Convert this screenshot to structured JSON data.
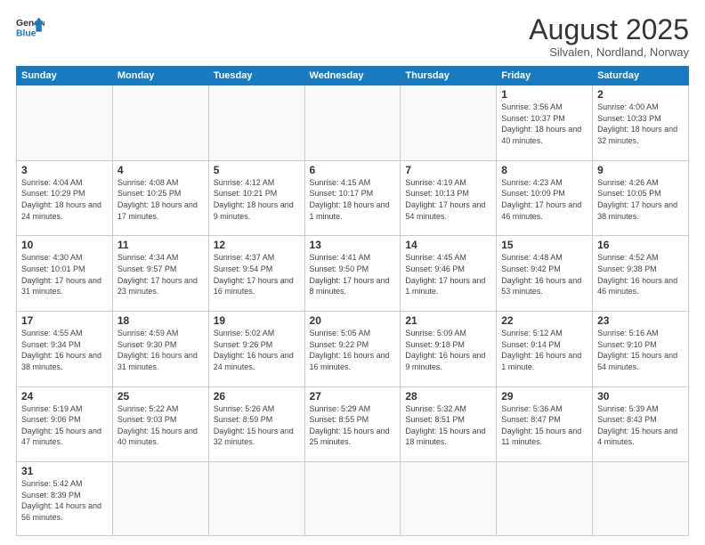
{
  "header": {
    "logo_general": "General",
    "logo_blue": "Blue",
    "month_title": "August 2025",
    "subtitle": "Silvalen, Nordland, Norway"
  },
  "days_of_week": [
    "Sunday",
    "Monday",
    "Tuesday",
    "Wednesday",
    "Thursday",
    "Friday",
    "Saturday"
  ],
  "weeks": [
    [
      {
        "day": "",
        "info": ""
      },
      {
        "day": "",
        "info": ""
      },
      {
        "day": "",
        "info": ""
      },
      {
        "day": "",
        "info": ""
      },
      {
        "day": "",
        "info": ""
      },
      {
        "day": "1",
        "info": "Sunrise: 3:56 AM\nSunset: 10:37 PM\nDaylight: 18 hours and 40 minutes."
      },
      {
        "day": "2",
        "info": "Sunrise: 4:00 AM\nSunset: 10:33 PM\nDaylight: 18 hours and 32 minutes."
      }
    ],
    [
      {
        "day": "3",
        "info": "Sunrise: 4:04 AM\nSunset: 10:29 PM\nDaylight: 18 hours and 24 minutes."
      },
      {
        "day": "4",
        "info": "Sunrise: 4:08 AM\nSunset: 10:25 PM\nDaylight: 18 hours and 17 minutes."
      },
      {
        "day": "5",
        "info": "Sunrise: 4:12 AM\nSunset: 10:21 PM\nDaylight: 18 hours and 9 minutes."
      },
      {
        "day": "6",
        "info": "Sunrise: 4:15 AM\nSunset: 10:17 PM\nDaylight: 18 hours and 1 minute."
      },
      {
        "day": "7",
        "info": "Sunrise: 4:19 AM\nSunset: 10:13 PM\nDaylight: 17 hours and 54 minutes."
      },
      {
        "day": "8",
        "info": "Sunrise: 4:23 AM\nSunset: 10:09 PM\nDaylight: 17 hours and 46 minutes."
      },
      {
        "day": "9",
        "info": "Sunrise: 4:26 AM\nSunset: 10:05 PM\nDaylight: 17 hours and 38 minutes."
      }
    ],
    [
      {
        "day": "10",
        "info": "Sunrise: 4:30 AM\nSunset: 10:01 PM\nDaylight: 17 hours and 31 minutes."
      },
      {
        "day": "11",
        "info": "Sunrise: 4:34 AM\nSunset: 9:57 PM\nDaylight: 17 hours and 23 minutes."
      },
      {
        "day": "12",
        "info": "Sunrise: 4:37 AM\nSunset: 9:54 PM\nDaylight: 17 hours and 16 minutes."
      },
      {
        "day": "13",
        "info": "Sunrise: 4:41 AM\nSunset: 9:50 PM\nDaylight: 17 hours and 8 minutes."
      },
      {
        "day": "14",
        "info": "Sunrise: 4:45 AM\nSunset: 9:46 PM\nDaylight: 17 hours and 1 minute."
      },
      {
        "day": "15",
        "info": "Sunrise: 4:48 AM\nSunset: 9:42 PM\nDaylight: 16 hours and 53 minutes."
      },
      {
        "day": "16",
        "info": "Sunrise: 4:52 AM\nSunset: 9:38 PM\nDaylight: 16 hours and 46 minutes."
      }
    ],
    [
      {
        "day": "17",
        "info": "Sunrise: 4:55 AM\nSunset: 9:34 PM\nDaylight: 16 hours and 38 minutes."
      },
      {
        "day": "18",
        "info": "Sunrise: 4:59 AM\nSunset: 9:30 PM\nDaylight: 16 hours and 31 minutes."
      },
      {
        "day": "19",
        "info": "Sunrise: 5:02 AM\nSunset: 9:26 PM\nDaylight: 16 hours and 24 minutes."
      },
      {
        "day": "20",
        "info": "Sunrise: 5:05 AM\nSunset: 9:22 PM\nDaylight: 16 hours and 16 minutes."
      },
      {
        "day": "21",
        "info": "Sunrise: 5:09 AM\nSunset: 9:18 PM\nDaylight: 16 hours and 9 minutes."
      },
      {
        "day": "22",
        "info": "Sunrise: 5:12 AM\nSunset: 9:14 PM\nDaylight: 16 hours and 1 minute."
      },
      {
        "day": "23",
        "info": "Sunrise: 5:16 AM\nSunset: 9:10 PM\nDaylight: 15 hours and 54 minutes."
      }
    ],
    [
      {
        "day": "24",
        "info": "Sunrise: 5:19 AM\nSunset: 9:06 PM\nDaylight: 15 hours and 47 minutes."
      },
      {
        "day": "25",
        "info": "Sunrise: 5:22 AM\nSunset: 9:03 PM\nDaylight: 15 hours and 40 minutes."
      },
      {
        "day": "26",
        "info": "Sunrise: 5:26 AM\nSunset: 8:59 PM\nDaylight: 15 hours and 32 minutes."
      },
      {
        "day": "27",
        "info": "Sunrise: 5:29 AM\nSunset: 8:55 PM\nDaylight: 15 hours and 25 minutes."
      },
      {
        "day": "28",
        "info": "Sunrise: 5:32 AM\nSunset: 8:51 PM\nDaylight: 15 hours and 18 minutes."
      },
      {
        "day": "29",
        "info": "Sunrise: 5:36 AM\nSunset: 8:47 PM\nDaylight: 15 hours and 11 minutes."
      },
      {
        "day": "30",
        "info": "Sunrise: 5:39 AM\nSunset: 8:43 PM\nDaylight: 15 hours and 4 minutes."
      }
    ],
    [
      {
        "day": "31",
        "info": "Sunrise: 5:42 AM\nSunset: 8:39 PM\nDaylight: 14 hours and 56 minutes."
      },
      {
        "day": "",
        "info": ""
      },
      {
        "day": "",
        "info": ""
      },
      {
        "day": "",
        "info": ""
      },
      {
        "day": "",
        "info": ""
      },
      {
        "day": "",
        "info": ""
      },
      {
        "day": "",
        "info": ""
      }
    ]
  ]
}
